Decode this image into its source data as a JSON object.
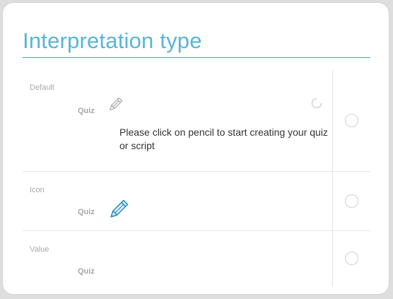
{
  "title": "Interpretation type",
  "rows": [
    {
      "label": "Default",
      "quiz_label": "Quiz",
      "pencil_icon": "pencil-icon-gray",
      "hint": "Please click on pencil to start creating your quiz or script",
      "spinner_icon": "refresh-icon",
      "selected": false
    },
    {
      "label": "Icon",
      "quiz_label": "Quiz",
      "pencil_icon": "pencil-icon-blue",
      "selected": false
    },
    {
      "label": "Value",
      "quiz_label": "Quiz",
      "selected": false
    }
  ],
  "colors": {
    "accent": "#3f9fc7",
    "title": "#5ab4d6",
    "muted_text": "#a8a8a8",
    "body_text": "#333333"
  }
}
